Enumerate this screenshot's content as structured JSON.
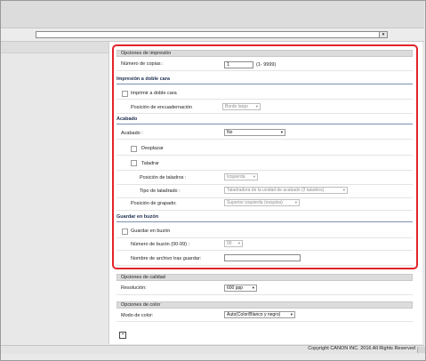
{
  "url_bar": {
    "value": "",
    "dropdown_glyph": "▾"
  },
  "print_options": {
    "header": "Opciones de impresión",
    "copies_label": "Número de copias :",
    "copies_value": "1",
    "copies_range": "(1- 9999)"
  },
  "duplex": {
    "header": "Impresión a doble cara",
    "print_duplex_label": "Imprimir a doble cara",
    "binding_label": "Posición de encuadernación",
    "binding_value": "Borde largo"
  },
  "finishing": {
    "header": "Acabado",
    "finishing_label": "Acabado :",
    "finishing_value": "No",
    "offset_label": "Desplazar",
    "punch_label": "Taladrar",
    "punch_position_label": "Posición de taladros :",
    "punch_position_value": "Izquierda",
    "punch_type_label": "Tipo de taladrado :",
    "punch_type_value": "Taladradora de la unidad de acabado (2 taladros)",
    "staple_label": "Posición de grapado:",
    "staple_value": "Superior izquierda (esquina)"
  },
  "mailbox": {
    "header": "Guardar en buzón",
    "store_label": "Guardar en buzón",
    "number_label": "Número de buzón (00-99) :",
    "number_value": "00",
    "filename_label": "Nombre de archivo tras guardar:",
    "filename_value": ""
  },
  "quality": {
    "header": "Opciones de calidad",
    "resolution_label": "Resolución:",
    "resolution_value": "600 ppp"
  },
  "color": {
    "header": "Opciones de color",
    "mode_label": "Modo de color:",
    "mode_value": "Auto(Color/Blanco y negro)"
  },
  "footer": {
    "copyright": "Copyright CANON INC. 2016 All Rights Reserved"
  },
  "colors": {
    "highlight": "#e2232a",
    "subheader_text": "#1b2b4f"
  },
  "icons": {
    "dropdown": "chevron-down-icon",
    "page_icon": "document-icon"
  }
}
